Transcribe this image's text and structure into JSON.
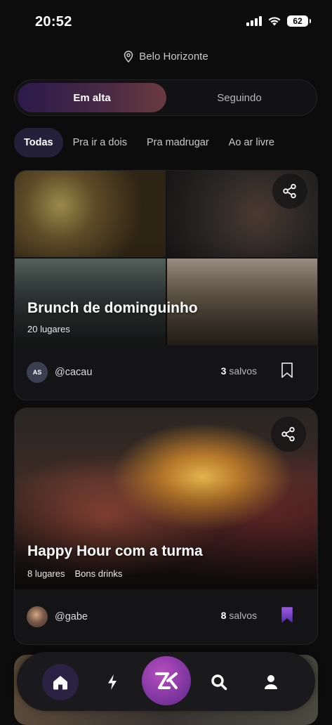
{
  "status_bar": {
    "time": "20:52",
    "battery": "62"
  },
  "header": {
    "location": "Belo Horizonte"
  },
  "segments": {
    "active": "Em alta",
    "inactive": "Seguindo"
  },
  "chips": [
    "Todas",
    "Pra ir a dois",
    "Pra madrugar",
    "Ao ar livre"
  ],
  "cards": [
    {
      "title": "Brunch de dominguinho",
      "meta": [
        "20 lugares"
      ],
      "author_initials": "AS",
      "author": "@cacau",
      "saves_count": "3",
      "saves_label": "salvos",
      "saved": false
    },
    {
      "title": "Happy Hour com a turma",
      "meta": [
        "8 lugares",
        "Bons drinks"
      ],
      "author_initials": "",
      "author": "@gabe",
      "saves_count": "8",
      "saves_label": "salvos",
      "saved": true
    }
  ],
  "tabs": [
    "home-icon",
    "bolt-icon",
    "app-logo",
    "search-icon",
    "profile-icon"
  ],
  "colors": {
    "accent": "#7b4fd0",
    "background": "#0c0c0d",
    "card": "#141416"
  }
}
